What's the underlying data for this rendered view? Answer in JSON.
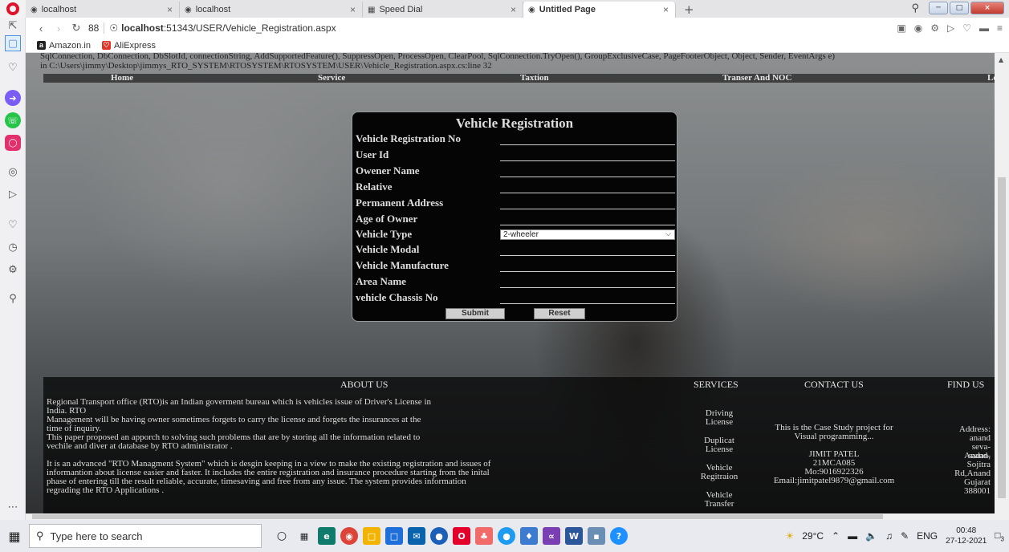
{
  "browser": {
    "tabs": [
      {
        "title": "localhost",
        "icon": "globe-icon"
      },
      {
        "title": "localhost",
        "icon": "globe-icon"
      },
      {
        "title": "Speed Dial",
        "icon": "grid-icon"
      },
      {
        "title": "Untitled Page",
        "icon": "globe-icon",
        "active": true
      }
    ],
    "url_host": "localhost",
    "url_rest": ":51343/USER/Vehicle_Registration.aspx",
    "speed_dial_count": "88",
    "bookmarks": [
      {
        "label": "Amazon.in",
        "icon": "amazon-icon"
      },
      {
        "label": "AliExpress",
        "icon": "aliexpress-icon"
      }
    ]
  },
  "page": {
    "error_lines": [
      "SqlConnection, DbConnection, DbSlotId, connectionString, AddSupportedFeature(), SuppressOpen, ProcessOpen, ClearPool, SqlConnection.TryOpen(), GroupExclusiveCase, PageFooterObject, Object, Sender, EventArgs e)",
      "in C:\\Users\\jimmy\\Desktop\\jimmys_RTO_SYSTEM\\RTOSYSTEM\\RTOSYSTEM\\USER\\Vehicle_Registration.aspx.cs:line 32"
    ],
    "menu": [
      "Home",
      "Service",
      "Taxtion",
      "Transer And NOC",
      "Lo"
    ],
    "form": {
      "title": "Vehicle Registration",
      "fields": [
        {
          "label": "Vehicle Registration No"
        },
        {
          "label": "User Id"
        },
        {
          "label": "Owener Name"
        },
        {
          "label": "Relative"
        },
        {
          "label": "Permanent Address"
        },
        {
          "label": "Age of Owner"
        },
        {
          "label": "Vehicle Type",
          "select": "2-wheeler"
        },
        {
          "label": "Vehicle Modal"
        },
        {
          "label": "Vehicle Manufacture"
        },
        {
          "label": "Area Name"
        },
        {
          "label": "vehicle Chassis No"
        }
      ],
      "submit_label": "Submit",
      "reset_label": "Reset"
    },
    "footer": {
      "about_heading": "ABOUT US",
      "about_lines": [
        "Regional Transport office (RTO)is an Indian goverment bureau which is vehicles issue of Driver's License in",
        "India. RTO",
        "Management will be having owner sometimes forgets to carry the license and forgets the insurances at the",
        "time of inquiry.",
        "This paper proposed an apporch to solving such problems that are by storing all the information related to",
        "vechile and diver at database by RTO administrator .",
        "",
        "It is an advanced \"RTO Managment System\" which is desgin keeping in a view to make the existing registration and issues of",
        "informantion about license easier and faster. It includes the entire registration and insurance procedure starting from the inital",
        "phase of entering till the result reliable, accurate, timesaving and free from any issue. The system provides information",
        "regrading the RTO Applications ."
      ],
      "services_heading": "SERVICES",
      "services": [
        [
          "Driving",
          "License"
        ],
        [
          "Duplicat",
          "License"
        ],
        [
          "Vehicle",
          "Regitraion"
        ],
        [
          "Vehicle",
          "Transfer"
        ]
      ],
      "contact_heading": "CONTACT US",
      "contact_lines": [
        "This is the Case Study project for",
        "Visual programming...",
        "",
        "JIMIT PATEL",
        "21MCA085",
        "Mo:9016922326",
        "Email:jimitpatel9879@gmail.com"
      ],
      "find_heading": "FIND US",
      "find_lines": [
        "Address:",
        "anand",
        "seva-sadan,",
        "Anand-",
        "Sojitra",
        "Rd,Anand",
        "Gujarat",
        "388001"
      ]
    }
  },
  "taskbar": {
    "search_placeholder": "Type here to search",
    "weather": "29°C",
    "lang": "ENG",
    "time": "00:48",
    "date": "27-12-2021",
    "notif_count": "3"
  }
}
